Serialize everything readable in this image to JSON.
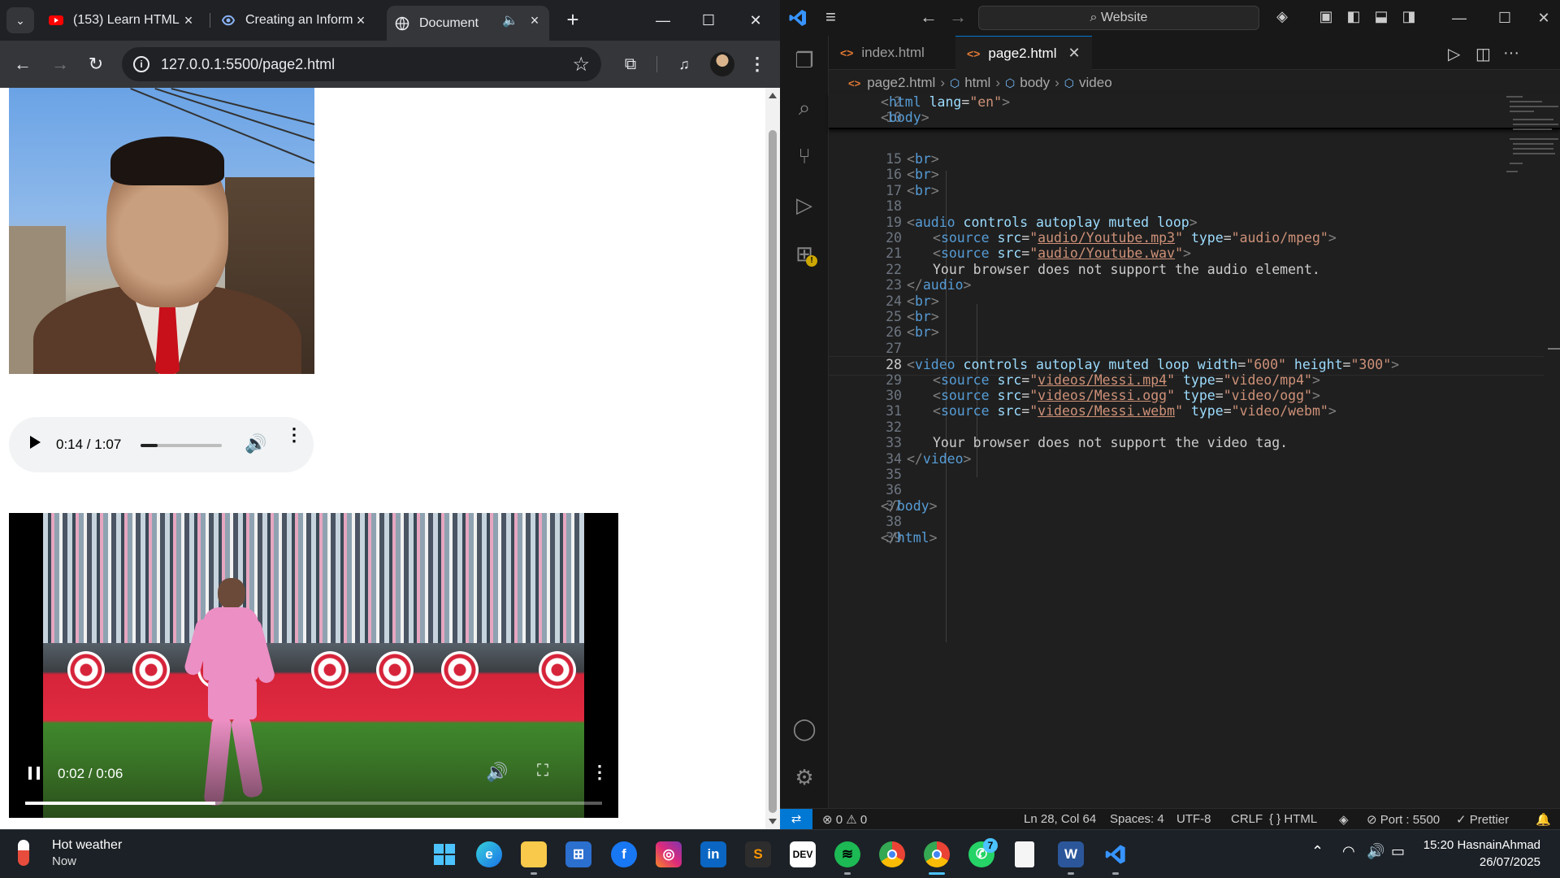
{
  "browser": {
    "tabs": [
      {
        "title": "(153) Learn HTML",
        "icon": "youtube-icon"
      },
      {
        "title": "Creating an Inform",
        "icon": "ai-icon"
      },
      {
        "title": "Document",
        "icon": "globe-icon",
        "active": true,
        "audio": true
      }
    ],
    "url": "127.0.0.1:5500/page2.html",
    "audio_player": {
      "time": "0:14 / 1:07",
      "progress": 0.21
    },
    "video_player": {
      "time": "0:02 / 0:06",
      "progress": 0.33
    }
  },
  "vscode": {
    "search": "Website",
    "tabs": [
      {
        "label": "index.html",
        "active": false
      },
      {
        "label": "page2.html",
        "active": true
      }
    ],
    "breadcrumbs": [
      "page2.html",
      "html",
      "body",
      "video"
    ],
    "sticky_lines": [
      {
        "num": "2",
        "code": "<html lang=\"en\">"
      },
      {
        "num": "10",
        "code": "<body>"
      }
    ],
    "lines": [
      {
        "num": "15",
        "indent": 2,
        "code": "<br>"
      },
      {
        "num": "16",
        "indent": 2,
        "code": "<br>"
      },
      {
        "num": "17",
        "indent": 2,
        "code": "<br>"
      },
      {
        "num": "18",
        "indent": 0,
        "code": ""
      },
      {
        "num": "19",
        "indent": 2,
        "code": "<audio controls autoplay muted loop>"
      },
      {
        "num": "20",
        "indent": 3,
        "code": "<source src=\"audio/Youtube.mp3\" type=\"audio/mpeg\">"
      },
      {
        "num": "21",
        "indent": 3,
        "code": "<source src=\"audio/Youtube.wav\">"
      },
      {
        "num": "22",
        "indent": 3,
        "code": "Your browser does not support the audio element."
      },
      {
        "num": "23",
        "indent": 2,
        "code": "</audio>"
      },
      {
        "num": "24",
        "indent": 2,
        "code": "<br>"
      },
      {
        "num": "25",
        "indent": 2,
        "code": "<br>"
      },
      {
        "num": "26",
        "indent": 2,
        "code": "<br>"
      },
      {
        "num": "27",
        "indent": 0,
        "code": ""
      },
      {
        "num": "28",
        "indent": 2,
        "code": "<video controls autoplay muted loop width=\"600\" height=\"300\">",
        "current": true
      },
      {
        "num": "29",
        "indent": 3,
        "code": "<source src=\"videos/Messi.mp4\" type=\"video/mp4\">"
      },
      {
        "num": "30",
        "indent": 3,
        "code": "<source src=\"videos/Messi.ogg\" type=\"video/ogg\">"
      },
      {
        "num": "31",
        "indent": 3,
        "code": "<source src=\"videos/Messi.webm\" type=\"video/webm\">"
      },
      {
        "num": "32",
        "indent": 0,
        "code": ""
      },
      {
        "num": "33",
        "indent": 3,
        "code": "Your browser does not support the video tag."
      },
      {
        "num": "34",
        "indent": 2,
        "code": "</video>"
      },
      {
        "num": "35",
        "indent": 0,
        "code": ""
      },
      {
        "num": "36",
        "indent": 0,
        "code": ""
      },
      {
        "num": "37",
        "indent": 1,
        "code": "</body>"
      },
      {
        "num": "38",
        "indent": 0,
        "code": ""
      },
      {
        "num": "39",
        "indent": 1,
        "code": "</html>"
      }
    ],
    "status": {
      "problems": "0",
      "warnings": "0",
      "position": "Ln 28, Col 64",
      "spaces": "Spaces: 4",
      "encoding": "UTF-8",
      "eol": "CRLF",
      "language": "HTML",
      "port": "Port : 5500",
      "formatter": "Prettier"
    }
  },
  "taskbar": {
    "weather_title": "Hot weather",
    "weather_sub": "Now",
    "time": "15:20 HasnainAhmad",
    "date": "26/07/2025",
    "whatsapp_badge": "7",
    "dev_label": "DEV"
  }
}
